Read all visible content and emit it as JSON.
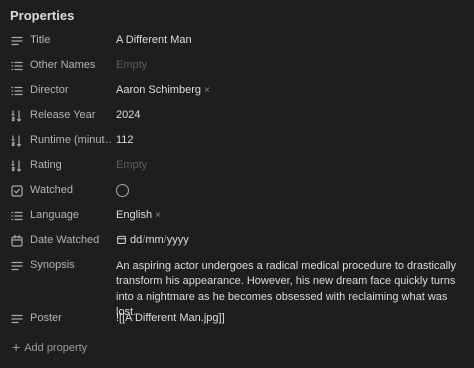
{
  "panel": {
    "heading": "Properties",
    "add_property_label": "Add property"
  },
  "properties": [
    {
      "label": "Title",
      "value": "A Different Man",
      "icon": "text-lines-icon"
    },
    {
      "label": "Other Names",
      "placeholder": "Empty",
      "icon": "list-icon"
    },
    {
      "label": "Director",
      "value": "Aaron Schimberg",
      "remove": "×",
      "icon": "list-icon"
    },
    {
      "label": "Release Year",
      "value": "2024",
      "icon": "number-icon"
    },
    {
      "label": "Runtime (minut…",
      "value": "112",
      "icon": "number-icon"
    },
    {
      "label": "Rating",
      "placeholder": "Empty",
      "icon": "number-icon"
    },
    {
      "label": "Watched",
      "checked": false,
      "icon": "checkbox-icon"
    },
    {
      "label": "Language",
      "value": "English",
      "remove": "×",
      "icon": "list-icon"
    },
    {
      "label": "Date Watched",
      "date_placeholder": {
        "dd": "dd",
        "mm": "mm",
        "yyyy": "yyyy",
        "sep": "/"
      },
      "icon": "calendar-icon"
    },
    {
      "label": "Synopsis",
      "value": "An aspiring actor undergoes a radical medical procedure to drastically transform his appearance. However, his new dream face quickly turns into a nightmare as he becomes obsessed with reclaiming what was lost.",
      "icon": "text-lines-icon"
    },
    {
      "label": "Poster",
      "value": "![[A Different Man.jpg]]",
      "icon": "text-lines-icon"
    }
  ],
  "colors": {
    "background": "#1e1e1e",
    "label": "#b3b3b3",
    "value": "#dcdcdc",
    "placeholder": "#5c5c5c"
  }
}
